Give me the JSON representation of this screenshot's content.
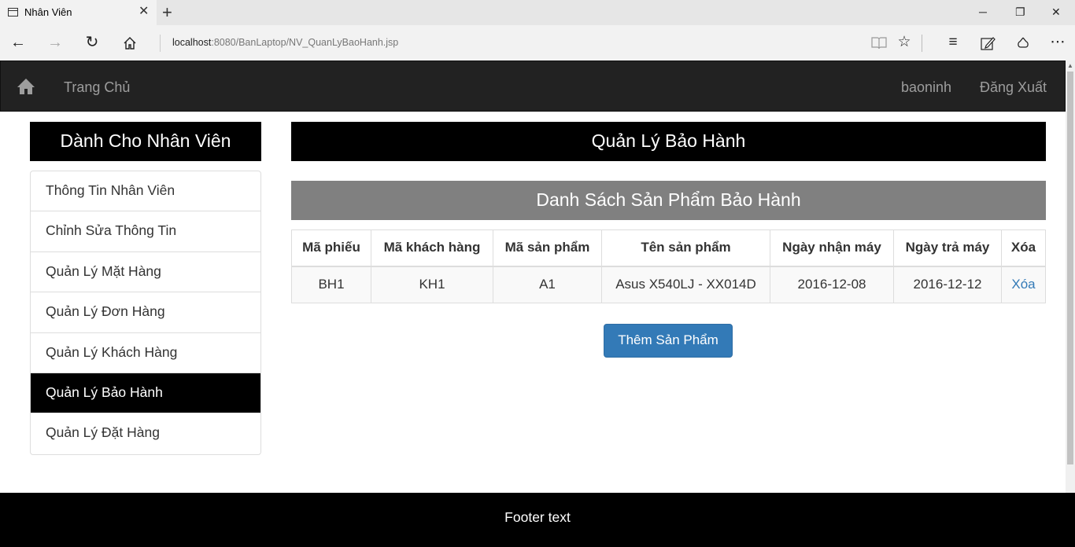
{
  "browser": {
    "tab_title": "Nhân Viên",
    "url_host": "localhost",
    "url_rest": ":8080/BanLaptop/NV_QuanLyBaoHanh.jsp"
  },
  "navbar": {
    "brand": "Trang Chủ",
    "user": "baoninh",
    "logout": "Đăng Xuất"
  },
  "sidebar": {
    "title": "Dành Cho Nhân Viên",
    "items": [
      {
        "label": "Thông Tin Nhân Viên"
      },
      {
        "label": "Chỉnh Sửa Thông Tin"
      },
      {
        "label": "Quản Lý Mặt Hàng"
      },
      {
        "label": "Quản Lý Đơn Hàng"
      },
      {
        "label": "Quản Lý Khách Hàng"
      },
      {
        "label": "Quản Lý Bảo Hành",
        "active": true
      },
      {
        "label": "Quản Lý Đặt Hàng"
      }
    ]
  },
  "main": {
    "title": "Quản Lý Bảo Hành",
    "subtitle": "Danh Sách Sản Phẩm Bảo Hành",
    "table": {
      "headers": [
        "Mã phiếu",
        "Mã khách hàng",
        "Mã sản phẩm",
        "Tên sản phẩm",
        "Ngày nhận máy",
        "Ngày trả máy",
        "Xóa"
      ],
      "rows": [
        [
          "BH1",
          "KH1",
          "A1",
          "Asus X540LJ - XX014D",
          "2016-12-08",
          "2016-12-12",
          "Xóa"
        ]
      ]
    },
    "add_button": "Thêm Sản Phẩm"
  },
  "footer": {
    "text": "Footer text"
  }
}
